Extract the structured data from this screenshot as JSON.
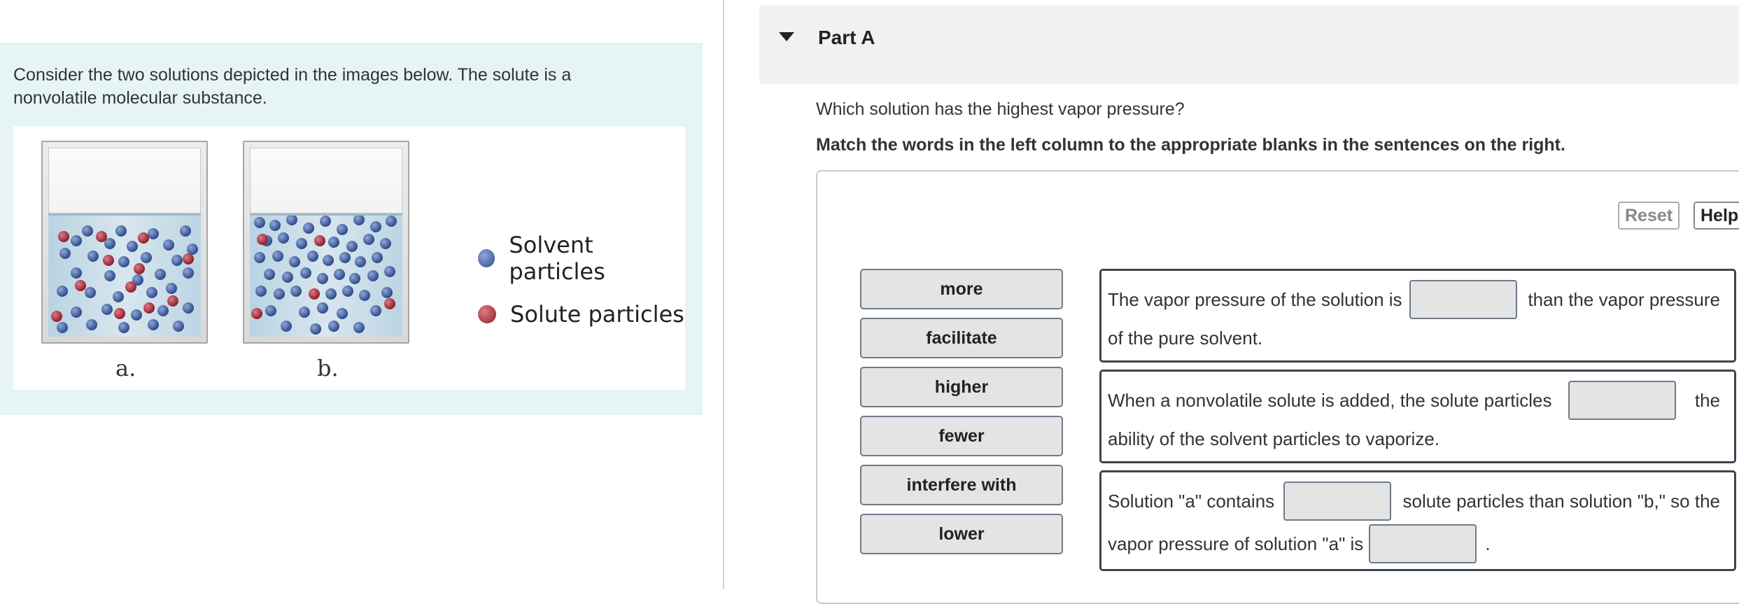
{
  "problem": {
    "intro": "Consider the two solutions depicted in the images below. The solute is a nonvolatile molecular substance.",
    "labels": {
      "a": "a.",
      "b": "b."
    },
    "legend": [
      {
        "text": "Solvent particles",
        "color": "#3d5b9a"
      },
      {
        "text": "Solute particles",
        "color": "#a12c3a"
      }
    ]
  },
  "part": {
    "title": "Part A"
  },
  "question": "Which solution has the highest vapor pressure?",
  "instruction": "Match the words in the left column to the appropriate blanks in the sentences on the right.",
  "toolbar": {
    "reset": "Reset",
    "help": "Help"
  },
  "word_bank": [
    "more",
    "facilitate",
    "higher",
    "fewer",
    "interfere with",
    "lower"
  ],
  "sentences": [
    {
      "p1": "The vapor pressure of the solution is",
      "p2": "than the vapor pressure",
      "p3": "of the pure solvent."
    },
    {
      "p1": "When a nonvolatile solute is added, the solute particles",
      "p2": "the",
      "p3": "ability of the solvent particles to vaporize."
    },
    {
      "p1": "Solution \"a\" contains",
      "p2": "solute particles than solution \"b,\" so the",
      "p3": "vapor pressure of solution \"a\" is",
      "p4": "."
    }
  ]
}
